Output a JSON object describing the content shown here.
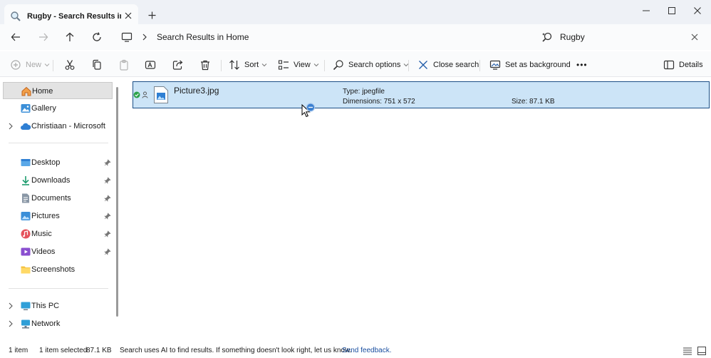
{
  "window": {
    "tab_title": "Rugby - Search Results in Home",
    "new_tab": "+",
    "minimize": "—",
    "maximize": "☐",
    "close": "✕"
  },
  "address": {
    "path": "Search Results in Home",
    "search_value": "Rugby"
  },
  "toolbar": {
    "new_label": "New",
    "sort_label": "Sort",
    "view_label": "View",
    "search_options_label": "Search options",
    "close_search_label": "Close search",
    "set_background_label": "Set as background",
    "more_label": "•••",
    "details_label": "Details"
  },
  "sidebar": {
    "items": [
      {
        "label": "Home",
        "icon": "home-icon",
        "selected": true
      },
      {
        "label": "Gallery",
        "icon": "gallery-icon"
      },
      {
        "label": "Christiaan - Microsoft",
        "icon": "cloud-icon",
        "expandable": true
      },
      {
        "label": "Desktop",
        "icon": "desktop-icon",
        "pinned": true
      },
      {
        "label": "Downloads",
        "icon": "download-icon",
        "pinned": true
      },
      {
        "label": "Documents",
        "icon": "documents-icon",
        "pinned": true
      },
      {
        "label": "Pictures",
        "icon": "pictures-icon",
        "pinned": true
      },
      {
        "label": "Music",
        "icon": "music-icon",
        "pinned": true
      },
      {
        "label": "Videos",
        "icon": "videos-icon",
        "pinned": true
      },
      {
        "label": "Screenshots",
        "icon": "folder-icon"
      },
      {
        "label": "This PC",
        "icon": "pc-icon",
        "expandable": true
      },
      {
        "label": "Network",
        "icon": "network-icon",
        "expandable": true
      }
    ]
  },
  "results": [
    {
      "name": "Picture3.jpg",
      "type": "Type: jpegfile",
      "dimensions": "Dimensions: 751 x 572",
      "size": "Size: 87.1 KB"
    }
  ],
  "status": {
    "count": "1 item",
    "selected": "1 item selected",
    "selected_size": "87.1 KB",
    "ai_notice": "Search uses AI to find results. If something doesn't look right, let us know.",
    "feedback": "Send feedback."
  },
  "colors": {
    "accent": "#1b4f86",
    "selection": "#cce4f7",
    "chrome": "#eef1f6"
  }
}
